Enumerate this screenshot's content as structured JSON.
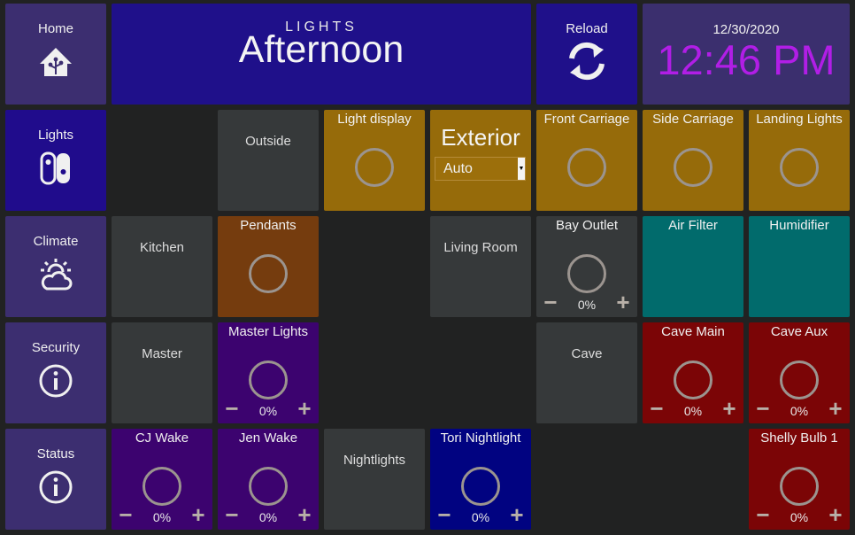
{
  "sidebar": {
    "home": "Home",
    "lights": "Lights",
    "climate": "Climate",
    "security": "Security",
    "status": "Status"
  },
  "header": {
    "page_label": "LIGHTS",
    "scene_name": "Afternoon"
  },
  "reload": {
    "label": "Reload"
  },
  "clock": {
    "date": "12/30/2020",
    "time": "12:46 PM",
    "time_color": "#b11ee6"
  },
  "tiles": {
    "outside": "Outside",
    "light_display": "Light display",
    "exterior": {
      "title": "Exterior",
      "selected": "Auto"
    },
    "front_carriage": "Front Carriage",
    "side_carriage": "Side Carriage",
    "landing_lights": "Landing Lights",
    "kitchen": "Kitchen",
    "pendants": "Pendants",
    "living_room": "Living Room",
    "bay_outlet": {
      "label": "Bay Outlet",
      "value": "0%"
    },
    "air_filter": "Air Filter",
    "humidifier": "Humidifier",
    "master": "Master",
    "master_lights": {
      "label": "Master Lights",
      "value": "0%"
    },
    "cave": "Cave",
    "cave_main": {
      "label": "Cave Main",
      "value": "0%"
    },
    "cave_aux": {
      "label": "Cave Aux",
      "value": "0%"
    },
    "cj_wake": {
      "label": "CJ Wake",
      "value": "0%"
    },
    "jen_wake": {
      "label": "Jen Wake",
      "value": "0%"
    },
    "nightlights": "Nightlights",
    "tori_nightlight": {
      "label": "Tori Nightlight",
      "value": "0%"
    },
    "shelly_bulb": {
      "label": "Shelly Bulb 1",
      "value": "0%"
    }
  },
  "colors": {
    "sidebar": "#3c2e70",
    "active": "#200c8c",
    "group": "#36393a",
    "exterior_light": "#966b0a",
    "pendant": "#753c0e",
    "bedroom": "#3c036f",
    "climate_device": "#016b6c",
    "cave": "#7b0506",
    "nightlight": "#010381"
  }
}
